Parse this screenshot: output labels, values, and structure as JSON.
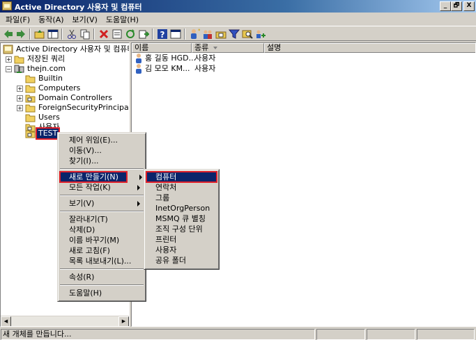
{
  "window": {
    "title": "Active Directory 사용자 및 컴퓨터",
    "buttons": [
      "_",
      "🗗",
      "X"
    ]
  },
  "menu": [
    "파일(F)",
    "동작(A)",
    "보기(V)",
    "도움말(H)"
  ],
  "tree": {
    "root": "Active Directory 사용자 및 컴퓨터",
    "saved_queries": "저장된 쿼리",
    "domain": "thejn.com",
    "children": [
      "Builtin",
      "Computers",
      "Domain Controllers",
      "ForeignSecurityPrincipals",
      "Users",
      "사용자",
      "TEST"
    ]
  },
  "list": {
    "columns": [
      "이름",
      "종류",
      "설명"
    ],
    "rows": [
      {
        "name": "홍 길동 HGD...",
        "type": "사용자"
      },
      {
        "name": "김 모모 KM...",
        "type": "사용자"
      }
    ]
  },
  "context_menu": {
    "items": [
      "제어 위임(E)...",
      "이동(V)...",
      "찾기(I)...",
      "새로 만들기(N)",
      "모든 작업(K)",
      "보기(V)",
      "잘라내기(T)",
      "삭제(D)",
      "이름 바꾸기(M)",
      "새로 고침(F)",
      "목록 내보내기(L)...",
      "속성(R)",
      "도움말(H)"
    ]
  },
  "submenu": {
    "items": [
      "컴퓨터",
      "연락처",
      "그룹",
      "InetOrgPerson",
      "MSMQ 큐 별칭",
      "조직 구성 단위",
      "프린터",
      "사용자",
      "공유 폴더"
    ]
  },
  "status": {
    "text": "새 개체를 만듭니다..."
  },
  "colors": {
    "titlebar": "#0a246a",
    "highlight": "#0a246a",
    "annotation": "#e0202a",
    "chrome": "#d4d0c8"
  }
}
